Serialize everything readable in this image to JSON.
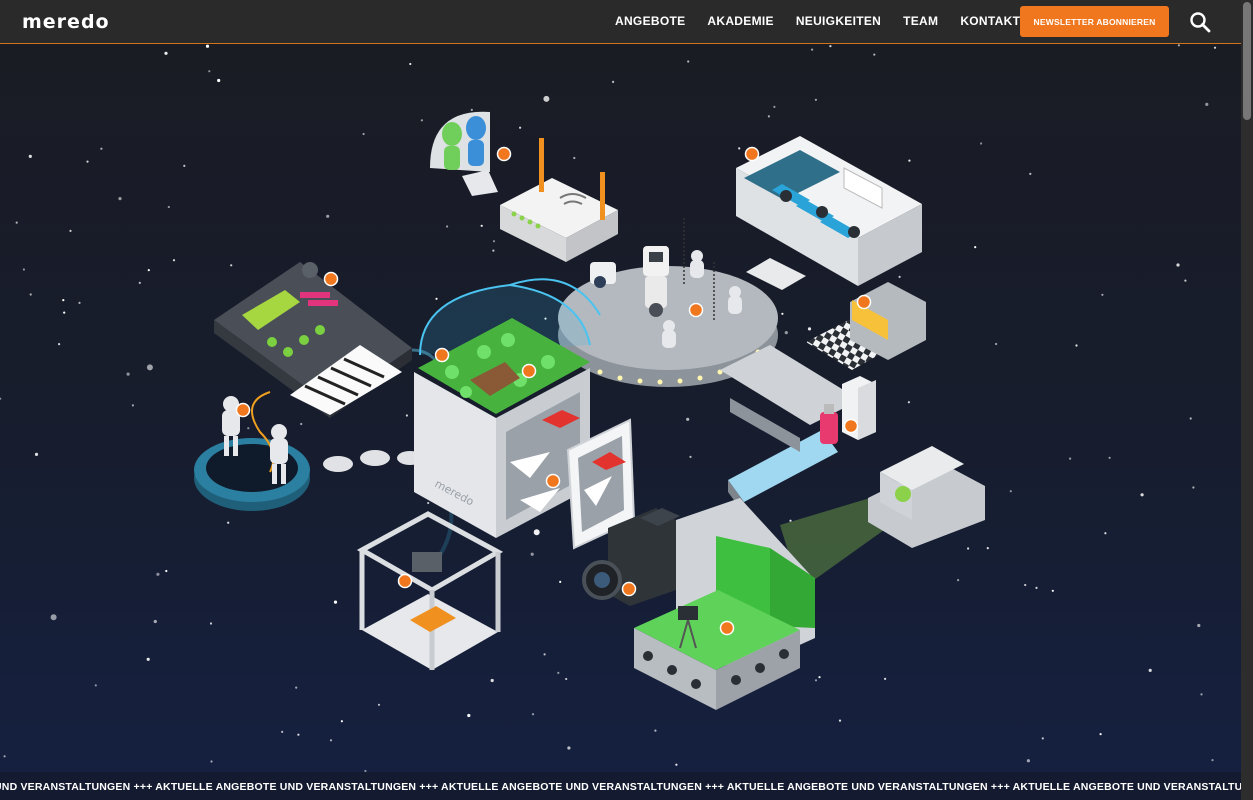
{
  "header": {
    "logo": "meredo",
    "nav": [
      "ANGEBOTE",
      "AKADEMIE",
      "NEUIGKEITEN",
      "TEAM",
      "KONTAKT"
    ],
    "newsletter_label": "NEWSLETTER ABONNIEREN"
  },
  "scene": {
    "box_label": "meredo"
  },
  "ticker": {
    "text": "UND VERANSTALTUNGEN +++ AKTUELLE ANGEBOTE UND VERANSTALTUNGEN +++ AKTUELLE ANGEBOTE UND VERANSTALTUNGEN +++ AKTUELLE ANGEBOTE UND VERANSTALTUNGEN +++ AKTUELLE ANGEBOTE UND VERANSTALTUNGEN +++ AKTUELLE ANGEBOTE UND VERANSTALTUNGEN +++"
  },
  "colors": {
    "accent": "#f0771e",
    "header_bg": "#2a2a2a",
    "space_bg": "#161b28",
    "green_screen": "#3fbf3f"
  }
}
